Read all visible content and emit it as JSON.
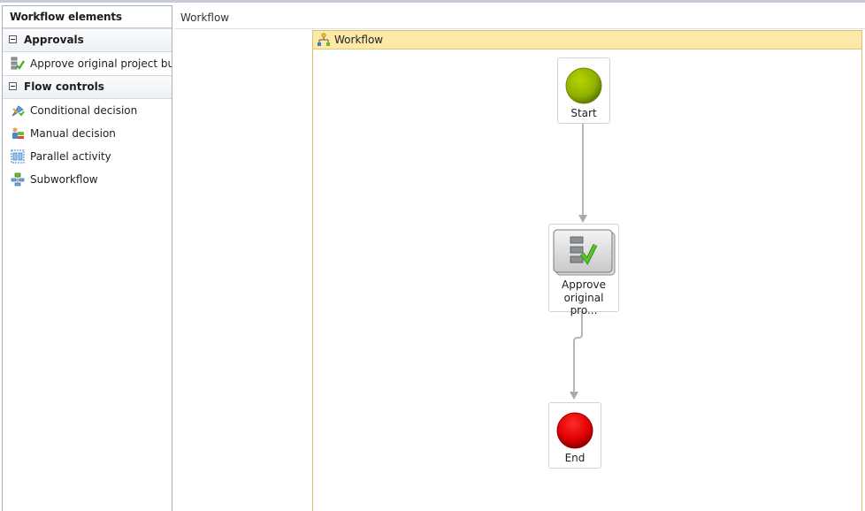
{
  "panel": {
    "title": "Workflow elements",
    "groups": [
      {
        "label": "Approvals",
        "items": [
          {
            "label": "Approve original project budg",
            "icon": "approval-icon"
          }
        ]
      },
      {
        "label": "Flow controls",
        "items": [
          {
            "label": "Conditional decision",
            "icon": "conditional-decision-icon"
          },
          {
            "label": "Manual decision",
            "icon": "manual-decision-icon"
          },
          {
            "label": "Parallel activity",
            "icon": "parallel-activity-icon"
          },
          {
            "label": "Subworkflow",
            "icon": "subworkflow-icon"
          }
        ]
      }
    ]
  },
  "canvas": {
    "breadcrumb": "Workflow",
    "container_title": "Workflow",
    "nodes": {
      "start": {
        "label": "Start",
        "color": "#8fb000"
      },
      "approval": {
        "label_line1": "Approve",
        "label_line2": "original pro...",
        "icon": "approval-icon"
      },
      "end": {
        "label": "End",
        "color": "#e00000"
      }
    },
    "colors": {
      "container_header": "#fce9a8",
      "container_border": "#d9c36e",
      "connector": "#b7b7b7"
    }
  }
}
